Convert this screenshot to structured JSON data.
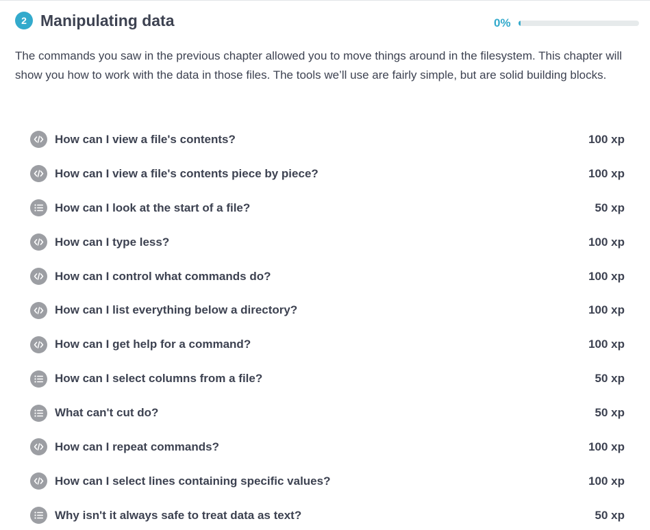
{
  "chapter": {
    "number": "2",
    "title": "Manipulating data",
    "progress_label": "0%",
    "progress_fraction": 0,
    "description": "The commands you saw in the previous chapter allowed you to move things around in the filesystem. This chapter will show you how to work with the data in those files. The tools we’ll use are fairly simple, but are solid building blocks."
  },
  "colors": {
    "accent": "#33aacc",
    "icon_bg": "#9c9ea3",
    "text": "#3d4251"
  },
  "lessons": [
    {
      "title": "How can I view a file's contents?",
      "xp": "100 xp",
      "icon": "code-icon"
    },
    {
      "title": "How can I view a file's contents piece by piece?",
      "xp": "100 xp",
      "icon": "code-icon"
    },
    {
      "title": "How can I look at the start of a file?",
      "xp": "50 xp",
      "icon": "list-icon"
    },
    {
      "title": "How can I type less?",
      "xp": "100 xp",
      "icon": "code-icon"
    },
    {
      "title": "How can I control what commands do?",
      "xp": "100 xp",
      "icon": "code-icon"
    },
    {
      "title": "How can I list everything below a directory?",
      "xp": "100 xp",
      "icon": "code-icon"
    },
    {
      "title": "How can I get help for a command?",
      "xp": "100 xp",
      "icon": "code-icon"
    },
    {
      "title": "How can I select columns from a file?",
      "xp": "50 xp",
      "icon": "list-icon"
    },
    {
      "title": "What can't cut do?",
      "xp": "50 xp",
      "icon": "list-icon"
    },
    {
      "title": "How can I repeat commands?",
      "xp": "100 xp",
      "icon": "code-icon"
    },
    {
      "title": "How can I select lines containing specific values?",
      "xp": "100 xp",
      "icon": "code-icon"
    },
    {
      "title": "Why isn't it always safe to treat data as text?",
      "xp": "50 xp",
      "icon": "list-icon"
    }
  ]
}
